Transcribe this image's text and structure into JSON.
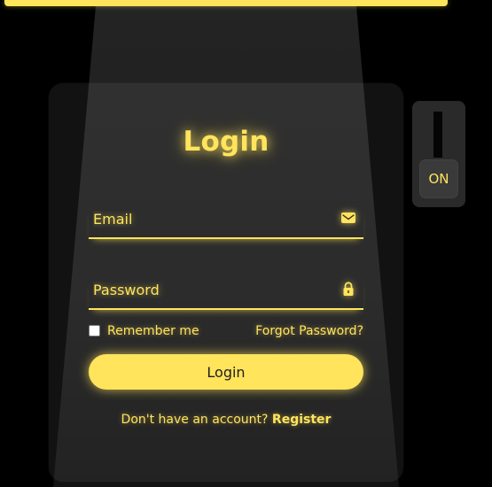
{
  "login": {
    "title": "Login",
    "email_placeholder": "Email",
    "password_placeholder": "Password",
    "remember_label": "Remember me",
    "remember_checked": false,
    "forgot_label": "Forgot Password?",
    "button_label": "Login",
    "register_prompt": "Don't have an account? ",
    "register_label": "Register"
  },
  "switch": {
    "label": "ON"
  },
  "icons": {
    "email": "envelope-icon",
    "password": "lock-icon"
  },
  "colors": {
    "accent": "#ffe45c",
    "background": "#000000",
    "button_text": "#1e1e1e"
  }
}
